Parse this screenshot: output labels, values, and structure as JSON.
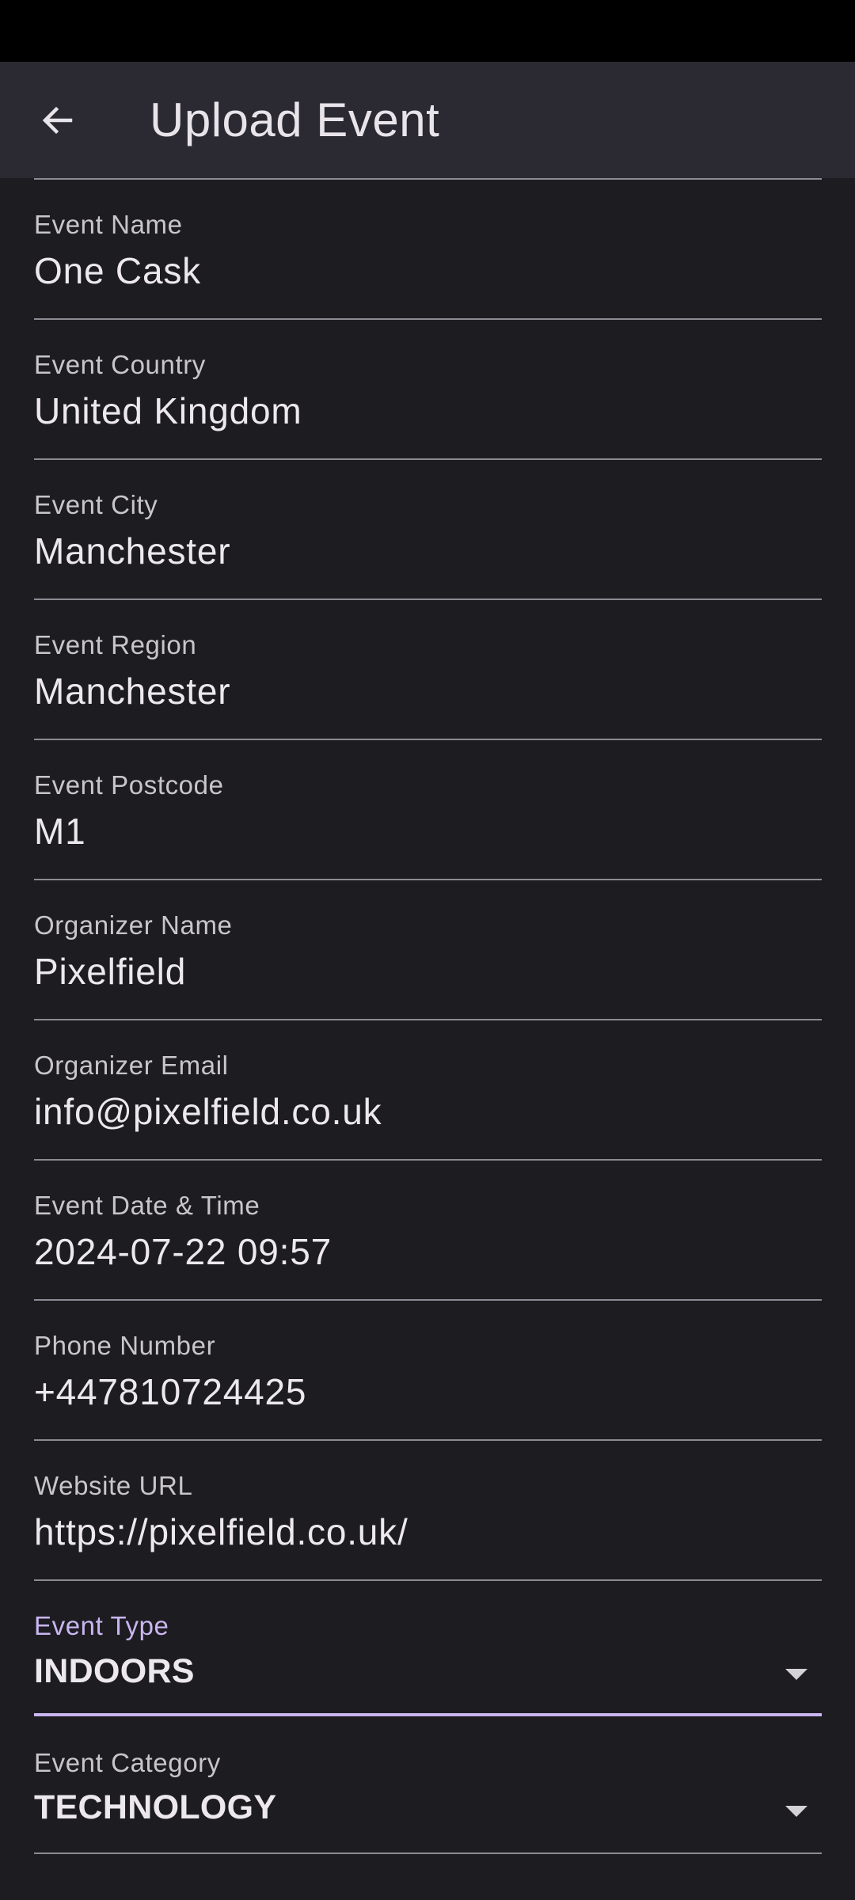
{
  "header": {
    "back_icon": "arrow-left-icon",
    "title": "Upload Event"
  },
  "colors": {
    "background": "#1d1c21",
    "app_bar": "#2b2a33",
    "accent": "#c9b6f0"
  },
  "fields": [
    {
      "label": "Event Name",
      "value": "One Cask"
    },
    {
      "label": "Event Country",
      "value": "United Kingdom"
    },
    {
      "label": "Event City",
      "value": "Manchester"
    },
    {
      "label": "Event Region",
      "value": "Manchester"
    },
    {
      "label": "Event Postcode",
      "value": "M1"
    },
    {
      "label": "Organizer Name",
      "value": "Pixelfield"
    },
    {
      "label": "Organizer Email",
      "value": "info@pixelfield.co.uk"
    },
    {
      "label": "Event Date & Time",
      "value": "2024-07-22 09:57"
    },
    {
      "label": "Phone Number",
      "value": "+447810724425"
    },
    {
      "label": "Website URL",
      "value": "https://pixelfield.co.uk/"
    }
  ],
  "dropdowns": [
    {
      "label": "Event Type",
      "value": "INDOORS",
      "icon": "dropdown-arrow-icon",
      "focused": true
    },
    {
      "label": "Event Category",
      "value": "TECHNOLOGY",
      "icon": "dropdown-arrow-icon",
      "focused": false
    }
  ]
}
